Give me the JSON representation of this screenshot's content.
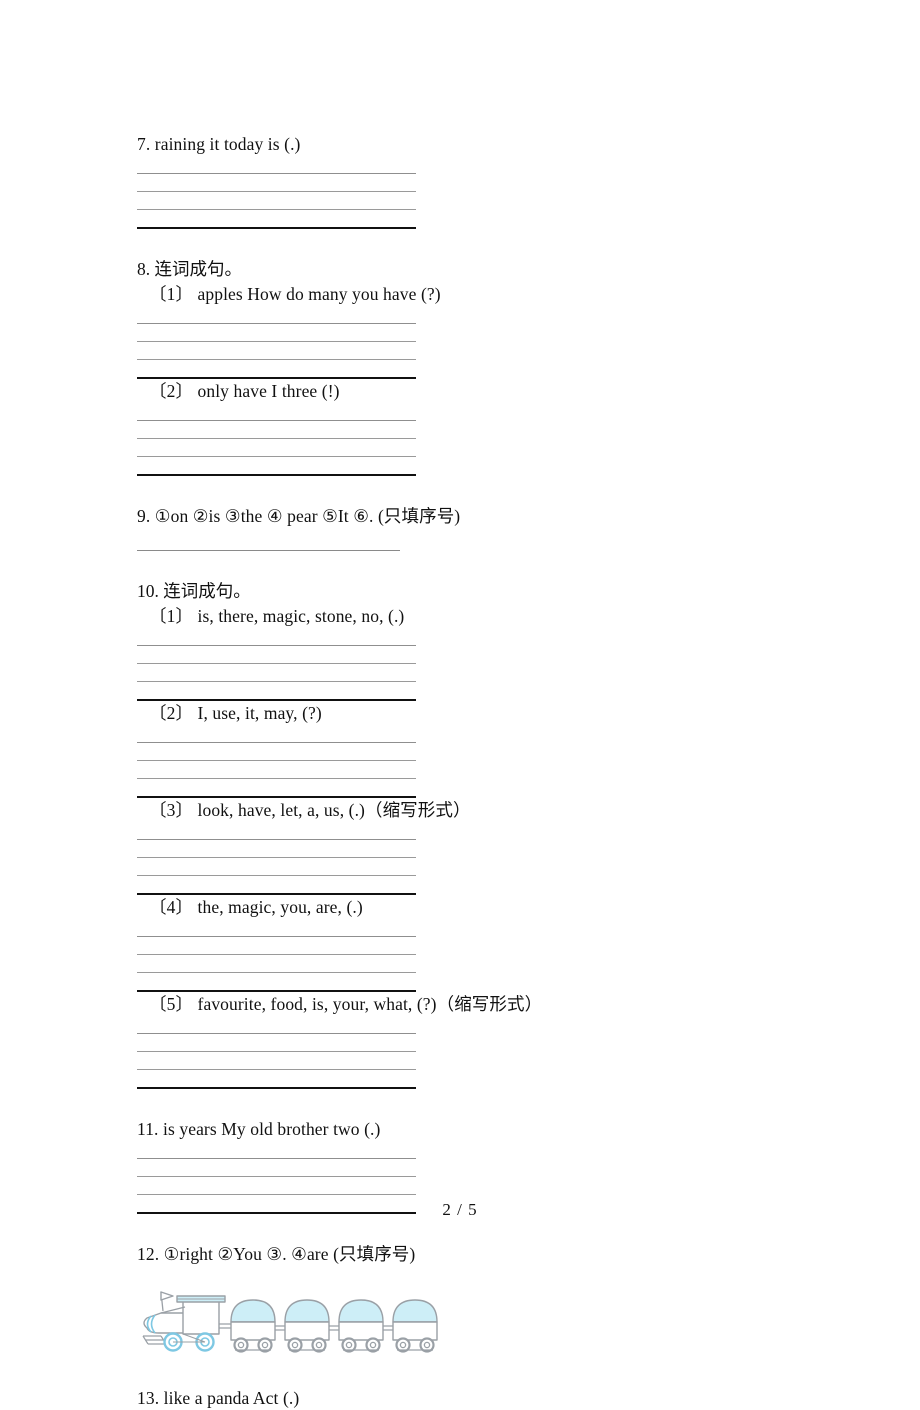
{
  "document": {
    "page_label": "2 / 5",
    "language_note": "Chinese primary-school English worksheet"
  },
  "items": [
    {
      "id": "q7",
      "number": "7.",
      "prompt": "7. raining  it  today  is (.)",
      "answer_lines": 4
    },
    {
      "id": "q8",
      "number": "8.",
      "heading": "8. 连词成句。",
      "subitems": [
        {
          "id": "q8-1",
          "label": "〔1〕",
          "prompt": "〔1〕 apples  How  do  many  you  have (?)",
          "answer_lines": 4
        },
        {
          "id": "q8-2",
          "label": "〔2〕",
          "prompt": "〔2〕 only  have  I  three (!)",
          "answer_lines": 4
        }
      ]
    },
    {
      "id": "q9",
      "number": "9.",
      "prompt": "9. ①on  ②is ③the  ④ pear  ⑤It  ⑥. (只填序号)",
      "answer_lines": 1
    },
    {
      "id": "q10",
      "number": "10.",
      "heading": "10. 连词成句。",
      "subitems": [
        {
          "id": "q10-1",
          "label": "〔1〕",
          "prompt": "〔1〕 is, there, magic, stone, no, (.)",
          "answer_lines": 4
        },
        {
          "id": "q10-2",
          "label": "〔2〕",
          "prompt": "〔2〕 I, use, it, may, (?)",
          "answer_lines": 4
        },
        {
          "id": "q10-3",
          "label": "〔3〕",
          "prompt": "〔3〕 look, have, let, a, us, (.)（缩写形式）",
          "answer_lines": 4
        },
        {
          "id": "q10-4",
          "label": "〔4〕",
          "prompt": "〔4〕 the, magic, you, are, (.)",
          "answer_lines": 4
        },
        {
          "id": "q10-5",
          "label": "〔5〕",
          "prompt": "〔5〕 favourite, food, is, your, what, (?)（缩写形式）",
          "answer_lines": 4
        }
      ]
    },
    {
      "id": "q11",
      "number": "11.",
      "prompt": "11. is    years    My    old    brother    two  (.)",
      "answer_lines": 4
    },
    {
      "id": "q12",
      "number": "12.",
      "prompt": "12. ①right  ②You  ③.  ④are (只填序号)",
      "illustration": "train-illustration",
      "illustration_colors": {
        "fill": "#cdeef7",
        "stroke": "#9aa0a6"
      }
    },
    {
      "id": "q13",
      "number": "13.",
      "prompt": "13. like a panda Act (.)"
    }
  ]
}
